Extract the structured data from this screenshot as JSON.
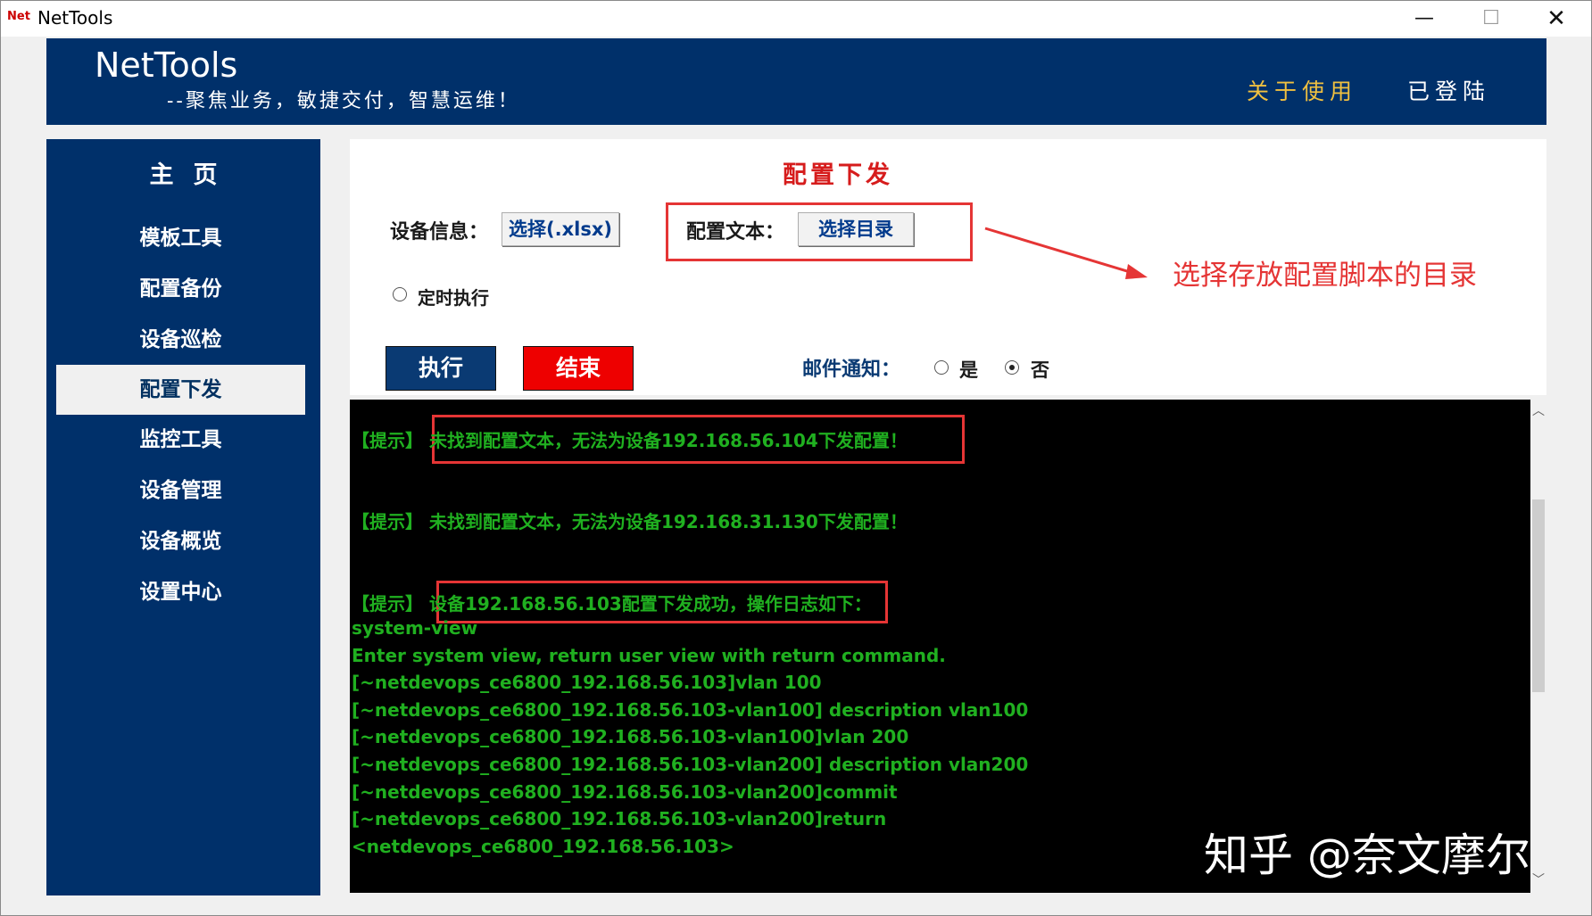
{
  "window": {
    "app_icon_text": "Net",
    "title": "NetTools",
    "min_glyph": "—",
    "max_glyph": "☐",
    "close_glyph": "✕"
  },
  "header": {
    "brand": "NetTools",
    "tagline": "--聚焦业务，敏捷交付，智慧运维！",
    "about_link": "关于使用",
    "login_status": "已登陆"
  },
  "sidebar": {
    "home": "主页",
    "items": [
      {
        "label": "模板工具"
      },
      {
        "label": "配置备份"
      },
      {
        "label": "设备巡检"
      },
      {
        "label": "配置下发",
        "active": true
      },
      {
        "label": "监控工具"
      },
      {
        "label": "设备管理"
      },
      {
        "label": "设备概览"
      },
      {
        "label": "设置中心"
      }
    ]
  },
  "main": {
    "title": "配置下发",
    "device_info_label": "设备信息：",
    "device_info_button": "选择(.xlsx)",
    "config_text_label": "配置文本：",
    "config_text_button": "选择目录",
    "scheduled_label": "定时执行",
    "run_button": "执行",
    "stop_button": "结束",
    "mail_label": "邮件通知：",
    "mail_yes": "是",
    "mail_no": "否",
    "mail_selected": "否"
  },
  "annotation": {
    "text": "选择存放配置脚本的目录",
    "color": "#e53535"
  },
  "console": {
    "lines": [
      "【提示】 未找到配置文本，无法为设备192.168.56.104下发配置！",
      "【提示】 未找到配置文本，无法为设备192.168.31.130下发配置！",
      "【提示】 设备192.168.56.103配置下发成功，操作日志如下：",
      "system-view",
      "Enter system view, return user view with return command.",
      "[~netdevops_ce6800_192.168.56.103]vlan 100",
      "[~netdevops_ce6800_192.168.56.103-vlan100] description vlan100",
      "[~netdevops_ce6800_192.168.56.103-vlan100]vlan 200",
      "[~netdevops_ce6800_192.168.56.103-vlan200] description vlan200",
      "[~netdevops_ce6800_192.168.56.103-vlan200]commit",
      "[~netdevops_ce6800_192.168.56.103-vlan200]return",
      "<netdevops_ce6800_192.168.56.103>"
    ],
    "text_color": "#20b020"
  },
  "watermark": "知乎 @奈文摩尔",
  "colors": {
    "navy": "#00306a",
    "accent_gold": "#f0c040",
    "stop_red": "#ee0000",
    "annotation_red": "#e53535"
  }
}
